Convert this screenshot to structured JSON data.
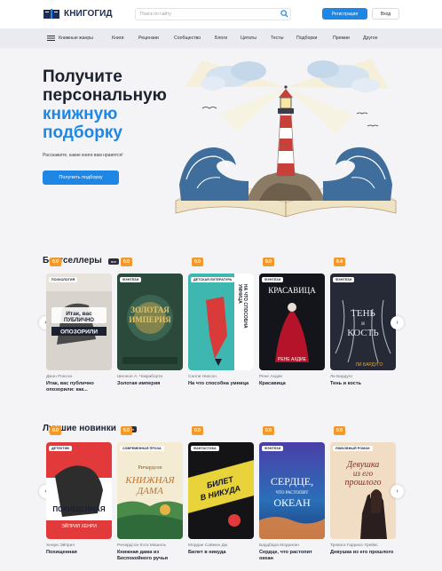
{
  "header": {
    "logo_text": "КНИГОГИД",
    "search_placeholder": "Поиск по сайту",
    "register_label": "Регистрация",
    "login_label": "Вход"
  },
  "nav": {
    "items": [
      "Книжные жанры",
      "Книги",
      "Рецензии",
      "Сообщество",
      "Блоги",
      "Цитаты",
      "Тесты",
      "Подборки",
      "Премии",
      "Другое"
    ]
  },
  "hero": {
    "title_line1": "Получите",
    "title_line2": "персональную",
    "title_line3": "книжную",
    "title_line4": "подборку",
    "subtitle": "Расскажите, какие книги вам нравятся!",
    "button_label": "Получить подборку"
  },
  "bestsellers": {
    "title": "Бестселлеры",
    "all_label": "все",
    "books": [
      {
        "genre": "ПСИХОЛОГИЯ",
        "rating": "0.0",
        "author": "Джон Ронсон",
        "title": "Итак, вас публично опозорили: как...",
        "cover_text": "Итак, вас ПУБЛИЧНО ОПОЗОРИЛИ"
      },
      {
        "genre": "ФЭНТЕЗИ",
        "rating": "0.0",
        "author": "Шеннон А. Чакраборти",
        "title": "Золотая империя",
        "cover_text": "ЗОЛОТАЯ ИМПЕРИЯ"
      },
      {
        "genre": "ДЕТСКАЯ ЛИТЕРАТУРА",
        "rating": "0.0",
        "author": "Салли Никсон",
        "title": "На что способна умница",
        "cover_text": "НА ЧТО СПОСОБНА УМНИЦА"
      },
      {
        "genre": "ФЭНТЕЗИ",
        "rating": "8.0",
        "author": "Рене Ахдие",
        "title": "Красавица",
        "cover_text": "КРАСАВИЦА"
      },
      {
        "genre": "ФЭНТЕЗИ",
        "rating": "8.4",
        "author": "Ли Бардуго",
        "title": "Тень и кость",
        "cover_text": "ТЕНЬ И КОСТЬ"
      }
    ]
  },
  "new_releases": {
    "title": "Лучшие новинки",
    "all_label": "все",
    "books": [
      {
        "genre": "ДЕТЕКТИВ",
        "rating": "0.0",
        "author": "Хенри Эйприл",
        "title": "Похищенная",
        "cover_text": "ПОХИЩЕННАЯ"
      },
      {
        "genre": "СОВРЕМЕННАЯ ПРОЗА",
        "rating": "5.0",
        "author": "Ричардсон Кэти Мишель",
        "title": "Книжная дама из Беспокойного ручья",
        "cover_text": "КНИЖНАЯ ДАМА"
      },
      {
        "genre": "ФАНТАСТИКА",
        "rating": "0.0",
        "author": "Мордан Саймон Дж.",
        "title": "Билет в никуда",
        "cover_text": "БИЛЕТ В НИКУДА"
      },
      {
        "genre": "ФЭНТЕЗИ",
        "rating": "0.0",
        "author": "Бардбара Морриган",
        "title": "Сердце, что растопит океан",
        "cover_text": "СЕРДЦЕ, ЧТО РАСТОПИТ ОКЕАН"
      },
      {
        "genre": "ЛЮБОВНЫЙ РОМАН",
        "rating": "0.0",
        "author": "Тревоги Гарриос-Грейвс",
        "title": "Девушка из его прошлого",
        "cover_text": "Девушка из его прошлого"
      }
    ]
  },
  "colors": {
    "accent": "#1e86e5",
    "rating": "#f29a2e",
    "dark": "#1c2130"
  }
}
